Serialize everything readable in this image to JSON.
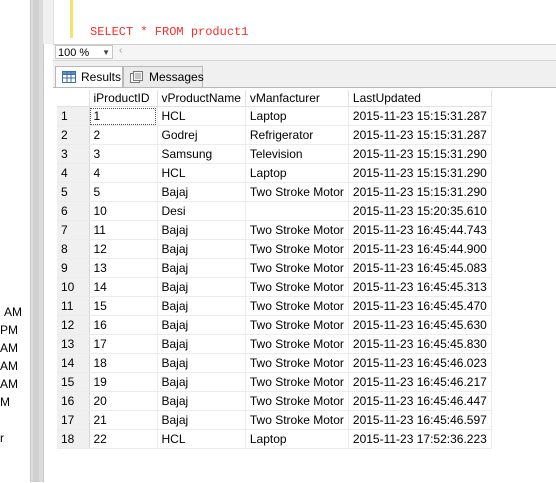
{
  "editor": {
    "query": "SELECT * FROM product1"
  },
  "zoom": {
    "value": "100 %"
  },
  "tabs": [
    {
      "label": "Results",
      "icon": "grid-icon",
      "active": true
    },
    {
      "label": "Messages",
      "icon": "messages-icon",
      "active": false
    }
  ],
  "left_fragments": [
    "AM",
    "PM",
    "AM",
    "AM",
    "AM",
    "M",
    "r"
  ],
  "grid": {
    "columns": [
      "iProductID",
      "vProductName",
      "vManfacturer",
      "LastUpdated"
    ],
    "rows": [
      {
        "n": "1",
        "id": "1",
        "name": "HCL",
        "mfr": "Laptop",
        "updated": "2015-11-23 15:15:31.287"
      },
      {
        "n": "2",
        "id": "2",
        "name": "Godrej",
        "mfr": "Refrigerator",
        "updated": "2015-11-23 15:15:31.287"
      },
      {
        "n": "3",
        "id": "3",
        "name": "Samsung",
        "mfr": "Television",
        "updated": "2015-11-23 15:15:31.290"
      },
      {
        "n": "4",
        "id": "4",
        "name": "HCL",
        "mfr": "Laptop",
        "updated": "2015-11-23 15:15:31.290"
      },
      {
        "n": "5",
        "id": "5",
        "name": "Bajaj",
        "mfr": "Two Stroke Motor",
        "updated": "2015-11-23 15:15:31.290"
      },
      {
        "n": "6",
        "id": "10",
        "name": "Desi",
        "mfr": "",
        "updated": "2015-11-23 15:20:35.610"
      },
      {
        "n": "7",
        "id": "11",
        "name": "Bajaj",
        "mfr": "Two Stroke Motor",
        "updated": "2015-11-23 16:45:44.743"
      },
      {
        "n": "8",
        "id": "12",
        "name": "Bajaj",
        "mfr": "Two Stroke Motor",
        "updated": "2015-11-23 16:45:44.900"
      },
      {
        "n": "9",
        "id": "13",
        "name": "Bajaj",
        "mfr": "Two Stroke Motor",
        "updated": "2015-11-23 16:45:45.083"
      },
      {
        "n": "10",
        "id": "14",
        "name": "Bajaj",
        "mfr": "Two Stroke Motor",
        "updated": "2015-11-23 16:45:45.313"
      },
      {
        "n": "11",
        "id": "15",
        "name": "Bajaj",
        "mfr": "Two Stroke Motor",
        "updated": "2015-11-23 16:45:45.470"
      },
      {
        "n": "12",
        "id": "16",
        "name": "Bajaj",
        "mfr": "Two Stroke Motor",
        "updated": "2015-11-23 16:45:45.630"
      },
      {
        "n": "13",
        "id": "17",
        "name": "Bajaj",
        "mfr": "Two Stroke Motor",
        "updated": "2015-11-23 16:45:45.830"
      },
      {
        "n": "14",
        "id": "18",
        "name": "Bajaj",
        "mfr": "Two Stroke Motor",
        "updated": "2015-11-23 16:45:46.023"
      },
      {
        "n": "15",
        "id": "19",
        "name": "Bajaj",
        "mfr": "Two Stroke Motor",
        "updated": "2015-11-23 16:45:46.217"
      },
      {
        "n": "16",
        "id": "20",
        "name": "Bajaj",
        "mfr": "Two Stroke Motor",
        "updated": "2015-11-23 16:45:46.447"
      },
      {
        "n": "17",
        "id": "21",
        "name": "Bajaj",
        "mfr": "Two Stroke Motor",
        "updated": "2015-11-23 16:45:46.597"
      },
      {
        "n": "18",
        "id": "22",
        "name": "HCL",
        "mfr": "Laptop",
        "updated": "2015-11-23 17:52:36.223"
      }
    ]
  }
}
